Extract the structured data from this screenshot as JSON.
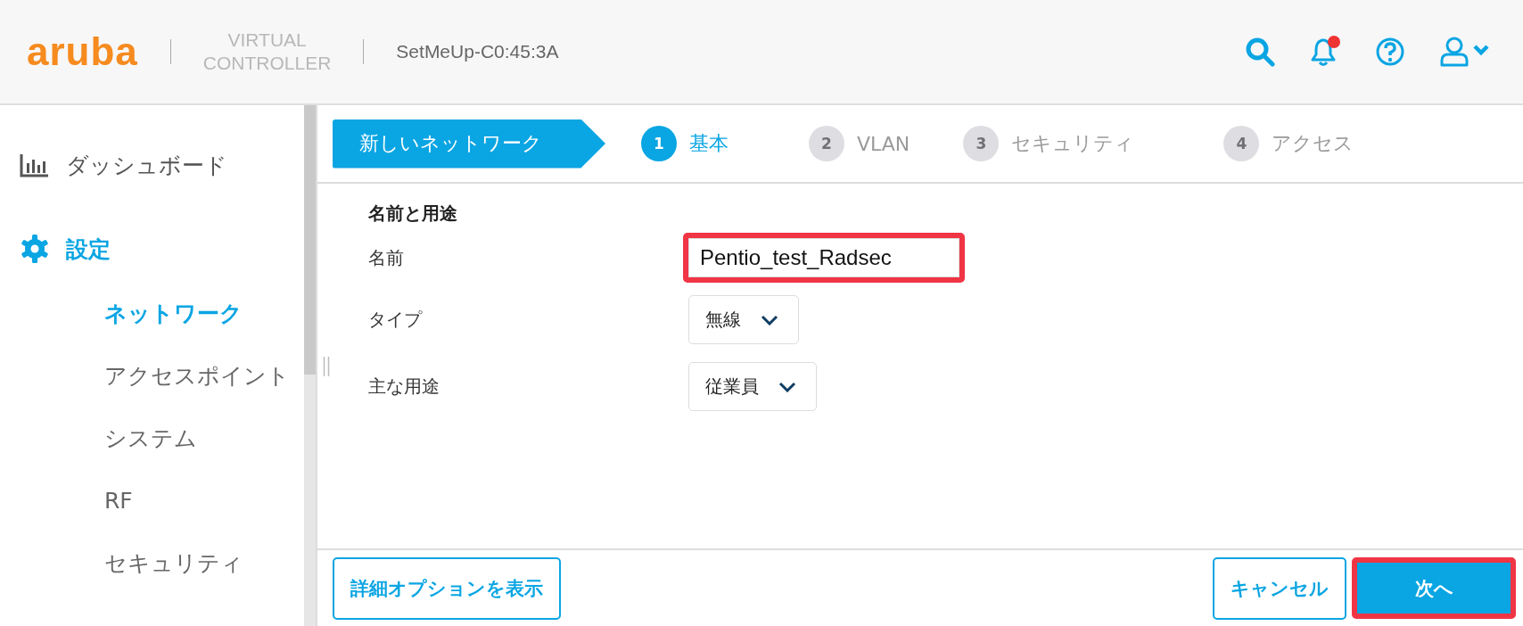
{
  "header": {
    "logo": "aruba",
    "product_line_1": "VIRTUAL",
    "product_line_2": "CONTROLLER",
    "device_name": "SetMeUp-C0:45:3A",
    "notification_unread": true
  },
  "sidebar": {
    "items": [
      {
        "kind": "dashboard",
        "label": "ダッシュボード",
        "selected": false
      },
      {
        "kind": "settings",
        "label": "設定",
        "selected": true,
        "children": [
          {
            "label": "ネットワーク",
            "selected": true
          },
          {
            "label": "アクセスポイント",
            "selected": false
          },
          {
            "label": "システム",
            "selected": false
          },
          {
            "label": "RF",
            "selected": false
          },
          {
            "label": "セキュリティ",
            "selected": false
          }
        ]
      }
    ]
  },
  "wizard": {
    "title": "新しいネットワーク",
    "steps": [
      {
        "number": "1",
        "label": "基本",
        "selected": true
      },
      {
        "number": "2",
        "label": "VLAN",
        "selected": false
      },
      {
        "number": "3",
        "label": "セキュリティ",
        "selected": false
      },
      {
        "number": "4",
        "label": "アクセス",
        "selected": false
      }
    ]
  },
  "form": {
    "section_title": "名前と用途",
    "fields": [
      {
        "kind": "text",
        "label": "名前",
        "value": "Pentio_test_Radsec",
        "highlighted": true
      },
      {
        "kind": "select",
        "label": "タイプ",
        "value": "無線",
        "highlighted": false
      },
      {
        "kind": "select",
        "label": "主な用途",
        "value": "従業員",
        "highlighted": false
      }
    ]
  },
  "footer": {
    "buttons": [
      {
        "kind": "outline",
        "label": "詳細オプションを表示",
        "highlighted": false
      },
      {
        "kind": "outline",
        "label": "キャンセル",
        "highlighted": false
      },
      {
        "kind": "primary",
        "label": "次へ",
        "highlighted": true
      }
    ]
  }
}
